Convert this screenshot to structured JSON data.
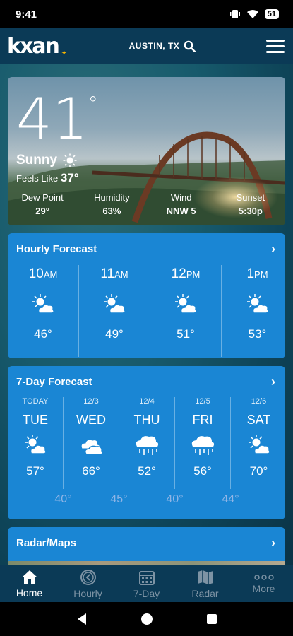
{
  "status_bar": {
    "time": "9:41",
    "battery": "51"
  },
  "header": {
    "logo": "kxan",
    "location": "AUSTIN, TX"
  },
  "current": {
    "temperature": "41",
    "degree": "°",
    "condition": "Sunny",
    "feels_like_label": "Feels Like",
    "feels_like_value": "37°",
    "stats": [
      {
        "label": "Dew Point",
        "value": "29°"
      },
      {
        "label": "Humidity",
        "value": "63%"
      },
      {
        "label": "Wind",
        "value": "NNW 5"
      },
      {
        "label": "Sunset",
        "value": "5:30p"
      }
    ]
  },
  "hourly": {
    "title": "Hourly Forecast",
    "hours": [
      {
        "hour": "10",
        "ampm": "AM",
        "temp": "46°",
        "icon": "partly-sunny-icon"
      },
      {
        "hour": "11",
        "ampm": "AM",
        "temp": "49°",
        "icon": "partly-sunny-icon"
      },
      {
        "hour": "12",
        "ampm": "PM",
        "temp": "51°",
        "icon": "partly-sunny-icon"
      },
      {
        "hour": "1",
        "ampm": "PM",
        "temp": "53°",
        "icon": "partly-sunny-icon"
      }
    ]
  },
  "daily": {
    "title": "7-Day Forecast",
    "days": [
      {
        "date": "TODAY",
        "name": "TUE",
        "high": "57°",
        "low": "40°",
        "icon": "partly-sunny-icon"
      },
      {
        "date": "12/3",
        "name": "WED",
        "high": "66°",
        "low": "45°",
        "icon": "cloudy-icon"
      },
      {
        "date": "12/4",
        "name": "THU",
        "high": "52°",
        "low": "40°",
        "icon": "rain-icon"
      },
      {
        "date": "12/5",
        "name": "FRI",
        "high": "56°",
        "low": "44°",
        "icon": "rain-icon"
      },
      {
        "date": "12/6",
        "name": "SAT",
        "high": "70°",
        "low": "",
        "icon": "partly-sunny-icon"
      }
    ]
  },
  "radar": {
    "title": "Radar/Maps"
  },
  "nav": {
    "items": [
      {
        "label": "Home",
        "icon": "home-icon",
        "active": true
      },
      {
        "label": "Hourly",
        "icon": "clock-icon",
        "active": false
      },
      {
        "label": "7-Day",
        "icon": "calendar-icon",
        "active": false
      },
      {
        "label": "Radar",
        "icon": "map-icon",
        "active": false
      },
      {
        "label": "More",
        "icon": "more-icon",
        "active": false
      }
    ]
  },
  "colors": {
    "card_blue": "#1a86d4",
    "header_navy": "#0b3a56",
    "low_temp": "#8fb5e6"
  }
}
